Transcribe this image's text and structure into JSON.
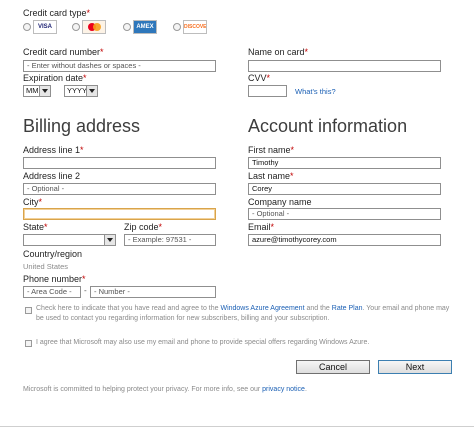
{
  "payment": {
    "card_type_label": "Credit card type",
    "cards": [
      {
        "name": "Visa",
        "text": "VISA",
        "color": "#1a1f71"
      },
      {
        "name": "MasterCard",
        "text": "MC",
        "color": "#eb001b"
      },
      {
        "name": "American Express",
        "text": "AMEX",
        "color": "#2e77bb"
      },
      {
        "name": "Discover",
        "text": "DISCOVER",
        "color": "#f76f20"
      }
    ],
    "card_number_label": "Credit card number",
    "card_number_placeholder": "- Enter without dashes or spaces -",
    "expiration_label": "Expiration date",
    "month_value": "MM",
    "year_value": "YYYY",
    "name_on_card_label": "Name on card",
    "cvv_label": "CVV",
    "whats_this_link": "What's this?"
  },
  "required_mark": "*",
  "billing": {
    "title": "Billing address",
    "address1_label": "Address line 1",
    "address2_label": "Address line 2",
    "address2_placeholder": "- Optional -",
    "city_label": "City",
    "state_label": "State",
    "zip_label": "Zip code",
    "zip_placeholder": "- Example: 97531 -",
    "country_label": "Country/region",
    "country_value": "United States",
    "phone_label": "Phone number",
    "area_code_placeholder": "- Area Code -",
    "phone_dash": "-",
    "number_placeholder": "- Number -"
  },
  "account": {
    "title": "Account information",
    "first_name_label": "First name",
    "first_name_value": "Timothy",
    "last_name_label": "Last name",
    "last_name_value": "Corey",
    "company_label": "Company name",
    "company_placeholder": "- Optional -",
    "email_label": "Email",
    "email_value": "azure@timothycorey.com"
  },
  "agreement": {
    "text_before": "Check here to indicate that you have read and agree to the ",
    "azure_agreement_link": "Windows Azure Agreement",
    "text_and": " and the ",
    "rate_plan_link": "Rate Plan",
    "text_after": ". Your email and phone may be used to contact you regarding information for new subscribers, billing and your subscription.",
    "offers_text": "I agree that Microsoft may also use my email and phone to provide special offers regarding Windows Azure."
  },
  "buttons": {
    "cancel": "Cancel",
    "next": "Next"
  },
  "privacy": {
    "text": "Microsoft is committed to helping protect your privacy. For more info, see our ",
    "link": "privacy notice",
    "end": "."
  },
  "colors": {
    "required": "#c00000",
    "link": "#1a5fb4",
    "focus_border": "#d9a44a"
  }
}
